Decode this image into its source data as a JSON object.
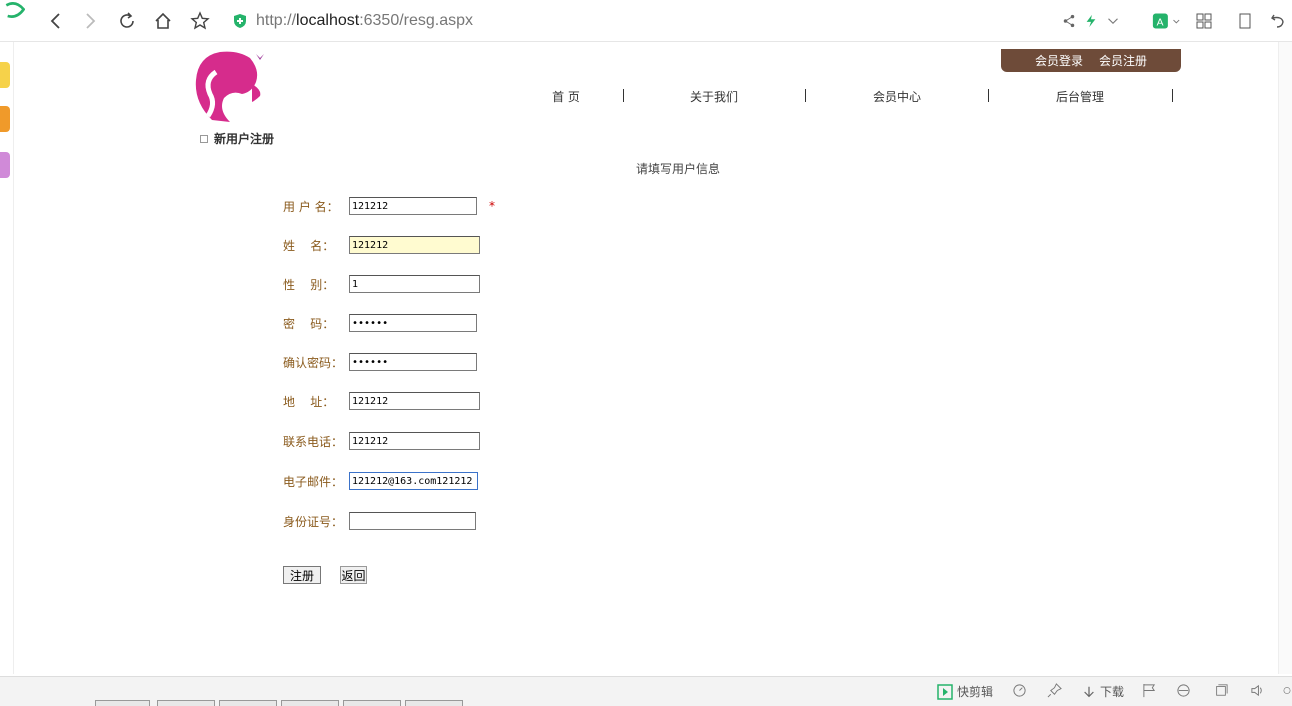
{
  "browser": {
    "url_proto": "http://",
    "url_host": "localhost",
    "url_rest": ":6350/resg.aspx",
    "icons": [
      "back-icon",
      "forward-icon",
      "refresh-icon",
      "home-icon",
      "star-icon",
      "shield-icon",
      "share-icon",
      "lightning-icon",
      "chevron-down-icon",
      "translate-icon",
      "apps-icon",
      "reading-icon",
      "undo-icon"
    ]
  },
  "header": {
    "login": "会员登录",
    "register": "会员注册",
    "nav": [
      "首 页",
      "关于我们",
      "会员中心",
      "后台管理"
    ]
  },
  "section_title": "新用户注册",
  "subtitle": "请填写用户信息",
  "form": {
    "username_label": "用 户 名：",
    "username_value": "121212",
    "required_mark": "*",
    "name_label": "姓    名：",
    "name_value": "121212",
    "gender_label": "性    别：",
    "gender_value": "1",
    "password_label": "密    码：",
    "password_value": "••••••",
    "confirm_label": "确认密码：",
    "confirm_value": "••••••",
    "address_label": "地    址：",
    "address_value": "121212",
    "phone_label": "联系电话：",
    "phone_value": "121212",
    "email_label": "电子邮件：",
    "email_value": "121212@163.com121212",
    "idcard_label": "身份证号：",
    "idcard_value": "",
    "submit": "注册",
    "back": "返回"
  },
  "statusbar": {
    "quick_cut": "快剪辑",
    "download": "下载"
  },
  "colors": {
    "member_bar": "#6e4b39",
    "label": "#8a5a1c",
    "highlight_input": "#fffbd0"
  }
}
